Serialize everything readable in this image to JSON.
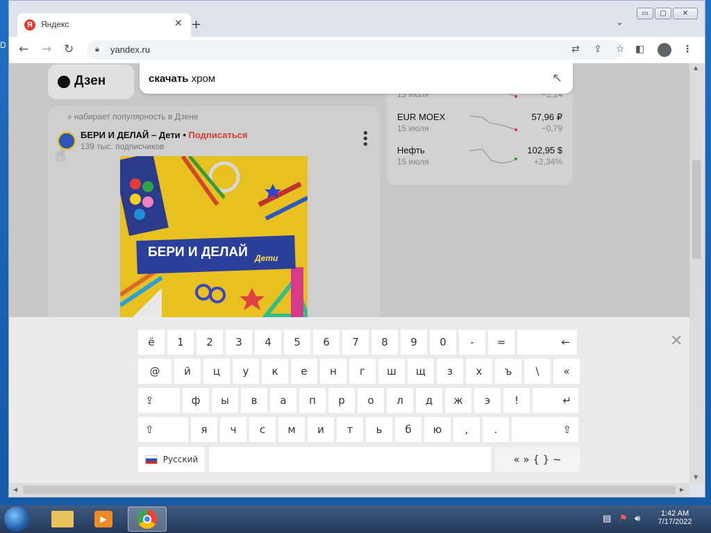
{
  "desktop": {
    "glyph": "D"
  },
  "browser": {
    "tab_title": "Яндекс",
    "tab_icon_letter": "Я",
    "url": "yandex.ru",
    "window_buttons": {
      "minimize": "▭",
      "maximize": "▢",
      "close": "✕"
    }
  },
  "page": {
    "logo_text": "Дзен",
    "search": {
      "bold_part": "скачать",
      "rest": "хром"
    },
    "feed": {
      "popular_label": "набирает популярность в Дзене",
      "channel_name": "БЕРИ И ДЕЛАЙ – Дети",
      "separator": "•",
      "subscribe": "Подписаться",
      "subscribers": "139 тыс. подписчиков",
      "thumb_title": "БЕРИ И ДЕЛАЙ",
      "thumb_sub": "Дети"
    },
    "stocks": [
      {
        "name": "",
        "date": "15 июля",
        "value": "",
        "change": "−1,14"
      },
      {
        "name": "EUR MOEX",
        "date": "15 июля",
        "value": "57,96 ₽",
        "change": "−0,79"
      },
      {
        "name": "Нефть",
        "date": "15 июля",
        "value": "102,95 $",
        "change": "+2,34%"
      }
    ]
  },
  "keyboard": {
    "row1": [
      "ё",
      "1",
      "2",
      "3",
      "4",
      "5",
      "6",
      "7",
      "8",
      "9",
      "0",
      "-",
      "=",
      "←"
    ],
    "row2": [
      "@",
      "й",
      "ц",
      "у",
      "к",
      "е",
      "н",
      "г",
      "ш",
      "щ",
      "з",
      "х",
      "ъ",
      "\\",
      "«"
    ],
    "row3": [
      "⇪",
      "ф",
      "ы",
      "в",
      "а",
      "п",
      "р",
      "о",
      "л",
      "д",
      "ж",
      "э",
      "!",
      "↵"
    ],
    "row4": [
      "⇧",
      "я",
      "ч",
      "с",
      "м",
      "и",
      "т",
      "ь",
      "б",
      "ю",
      ",",
      ".",
      "⇧"
    ],
    "language": "Русский",
    "symbols": "« » { } ~",
    "close": "✕"
  },
  "taskbar": {
    "time": "1:42 AM",
    "date": "7/17/2022"
  },
  "colors": {
    "accent_red": "#d53f2f",
    "chart_red": "#e0303a",
    "chart_green": "#2e9e3e"
  }
}
